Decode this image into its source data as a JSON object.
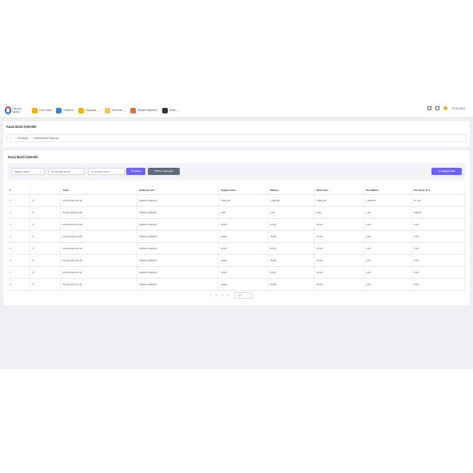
{
  "brand": {
    "logo_text": "Lokanta Yazılım"
  },
  "nav": {
    "items": [
      {
        "label": "Hızlı Satış",
        "icon": "fast-sale-icon",
        "color": "#f5b301",
        "has_menu": false
      },
      {
        "label": "Kullanıcı",
        "icon": "users-icon",
        "color": "#3b82c4",
        "has_menu": false
      },
      {
        "label": "Raporlar",
        "icon": "report-icon",
        "color": "#e6b800",
        "has_menu": true
      },
      {
        "label": "Tanımlar",
        "icon": "definitions-icon",
        "color": "#f5c542",
        "has_menu": true
      },
      {
        "label": "Müşteri İşlemleri",
        "icon": "customer-icon",
        "color": "#e86b2c",
        "has_menu": false
      },
      {
        "label": "Kasa",
        "icon": "cash-register-icon",
        "color": "#333333",
        "has_menu": true
      }
    ],
    "date": "22.06.2023"
  },
  "header": {
    "title": "Kasa Bazlı İşlemler",
    "breadcrumb": [
      "Anasayfa",
      "Harekti Bazlı Raporlar"
    ]
  },
  "main": {
    "section_title": "Kasa Bazlı İşlemler",
    "filters": {
      "select_value": "IRMAK, ARAS",
      "start_date": "22.06.2023 15:15",
      "end_date": "22.06.2023 14:15",
      "filter_button": "Listele",
      "back_button": "Son 1 gün geri",
      "export_button": "Belgeyi İndir"
    },
    "table": {
      "columns": [
        "#",
        "",
        "Tarih",
        "Kullanıcı adı",
        "Toplam tutar",
        "Maliyet",
        "KDV hariç",
        "Kar Miktarı",
        "Kar Oranı (%)"
      ],
      "rows": [
        [
          "1",
          "5",
          "22.06.2023 12:43",
          "IRMAK ARMAN",
          "4.359,00",
          "1.800,00",
          "2.682,00",
          "1.864,00",
          "67,1%"
        ],
        [
          "2",
          "5",
          "22.06.2023 12:46",
          "IRMAK ARMAN",
          "2,00",
          "1,00",
          "2,00",
          "1,66",
          "189,00"
        ],
        [
          "3",
          "5",
          "22.06.2023 12:39",
          "IRMAK ARMAN",
          "30,00",
          "25,00",
          "25,19",
          "0,19",
          "0,34"
        ],
        [
          "4",
          "5",
          "22.06.2023 12:06",
          "IRMAK ARMAN",
          "44,00",
          "38,00",
          "41,19",
          "3,19",
          "8,39"
        ],
        [
          "5",
          "5",
          "22.06.2023 13:40",
          "IRMAK ARMAN",
          "30,00",
          "25,00",
          "25,19",
          "0,19",
          "0,34"
        ],
        [
          "6",
          "5",
          "22.06.2023 13:40",
          "IRMAK ARMAN",
          "30,00",
          "25,00",
          "25,19",
          "0,19",
          "0,34"
        ],
        [
          "7",
          "5",
          "22.06.2023 13:41",
          "IRMAK ARMAN",
          "30,00",
          "25,00",
          "25,19",
          "0,19",
          "0,34"
        ],
        [
          "8",
          "5",
          "22.06.2023 14:41",
          "IRMAK ARMAN",
          "30,00",
          "25,00",
          "25,19",
          "0,19",
          "0,34"
        ]
      ]
    },
    "pager": {
      "prev": "«",
      "page1": "1",
      "page2": "2",
      "next": "»",
      "size": "100"
    }
  }
}
